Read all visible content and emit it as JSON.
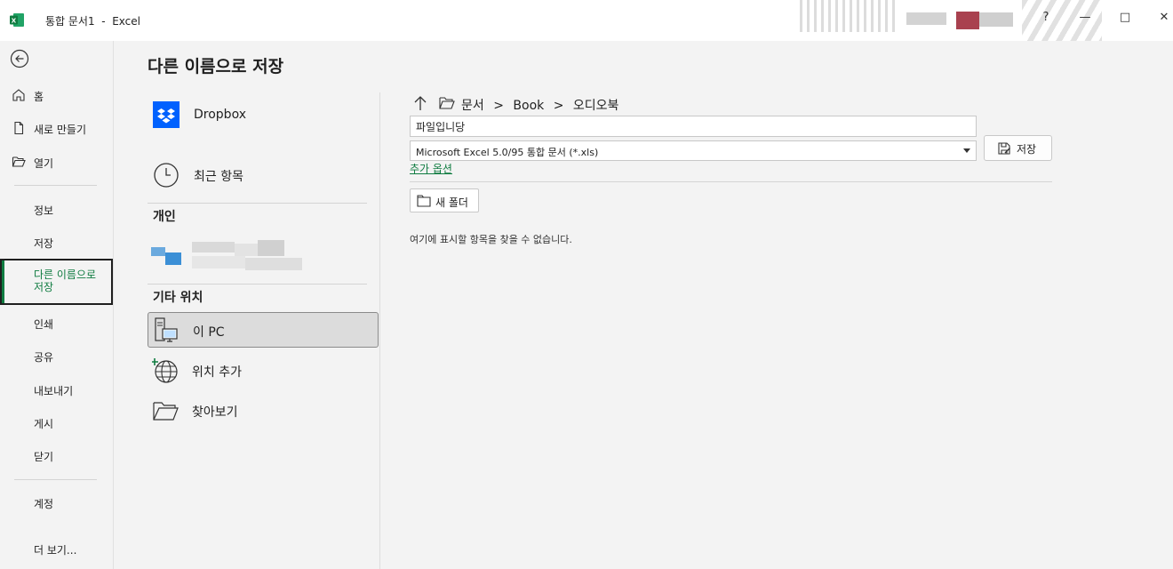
{
  "titlebar": {
    "app_title": "통합 문서1  -  Excel",
    "help": "?",
    "minimize": "—",
    "maximize": "□",
    "close": "✕"
  },
  "nav": {
    "home": "홈",
    "new": "새로 만들기",
    "open": "열기",
    "info": "정보",
    "save": "저장",
    "save_as": "다른 이름으로 저장",
    "print": "인쇄",
    "share": "공유",
    "export": "내보내기",
    "publish": "게시",
    "close": "닫기",
    "account": "계정",
    "more": "더 보기..."
  },
  "main": {
    "title": "다른 이름으로 저장",
    "locations": {
      "dropbox": "Dropbox",
      "recent": "최근 항목",
      "personal_header": "개인",
      "other_header": "기타 위치",
      "this_pc": "이 PC",
      "add_place": "위치 추가",
      "browse": "찾아보기"
    }
  },
  "right": {
    "breadcrumb": [
      "문서",
      ">",
      "Book",
      ">",
      "오디오북"
    ],
    "filename": "파일입니당",
    "filetype": "Microsoft Excel 5.0/95 통합 문서 (*.xls)",
    "save_label": "저장",
    "more_options": "추가 옵션",
    "new_folder": "새 폴더",
    "empty_message": "여기에 표시할 항목을 찾을 수 없습니다."
  },
  "colors": {
    "accent": "#107c41",
    "dropbox": "#0061fe"
  }
}
